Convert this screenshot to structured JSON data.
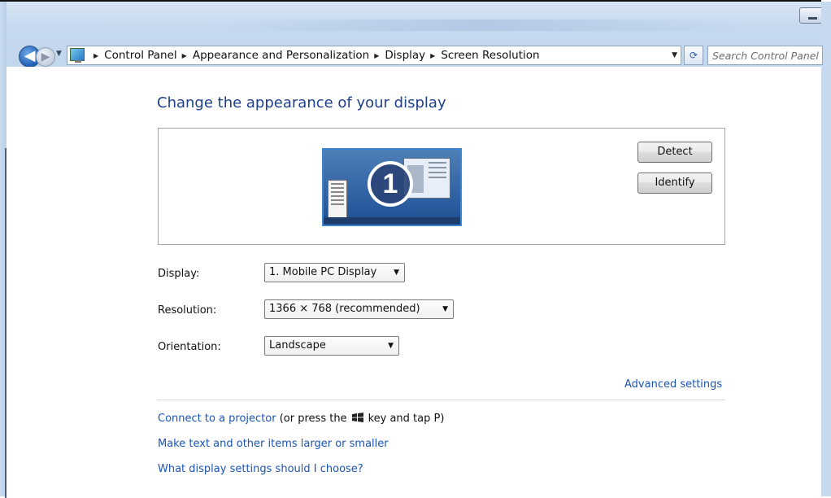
{
  "window": {
    "minimize_label": "Minimize"
  },
  "nav": {
    "back_glyph": "◀",
    "forward_glyph": "▶",
    "breadcrumbs": [
      "Control Panel",
      "Appearance and Personalization",
      "Display",
      "Screen Resolution"
    ],
    "search_placeholder": "Search Control Panel",
    "refresh_glyph": "⟳"
  },
  "main": {
    "title": "Change the appearance of your display",
    "monitor_number": "1",
    "detect_label": "Detect",
    "identify_label": "Identify",
    "display_label": "Display:",
    "display_value": "1. Mobile PC Display",
    "resolution_label": "Resolution:",
    "resolution_value": "1366 × 768 (recommended)",
    "orientation_label": "Orientation:",
    "orientation_value": "Landscape",
    "advanced_settings": "Advanced settings",
    "projector_link": "Connect to a projector",
    "projector_text_pre": "(or press the",
    "projector_text_post": "key and tap P)",
    "larger_text_link": "Make text and other items larger or smaller",
    "choose_link": "What display settings should I choose?"
  },
  "icons": {
    "control_panel": "control-panel-icon",
    "windows_key": "windows-logo-icon",
    "dropdown": "chevron-down-icon"
  },
  "colors": {
    "link": "#1a55b5",
    "title": "#1e3f8a",
    "monitor_border": "#3c86d1"
  }
}
